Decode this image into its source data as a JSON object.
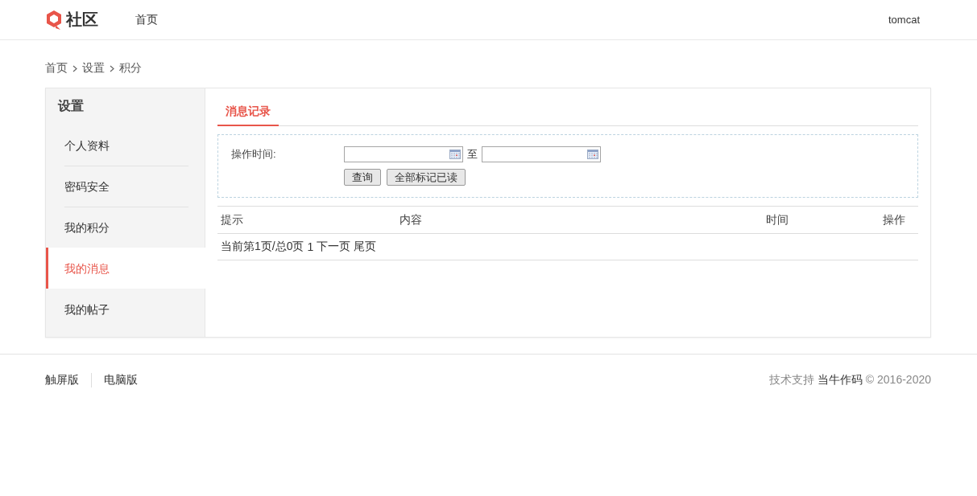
{
  "header": {
    "logo_text": "社区",
    "nav": [
      {
        "label": "首页",
        "selected": false
      }
    ],
    "user": "tomcat"
  },
  "breadcrumb": [
    "首页",
    "设置",
    "积分"
  ],
  "sidebar": {
    "title": "设置",
    "items": [
      {
        "label": "个人资料",
        "selected": false
      },
      {
        "label": "密码安全",
        "selected": false
      },
      {
        "label": "我的积分",
        "selected": false
      },
      {
        "label": "我的消息",
        "selected": true
      },
      {
        "label": "我的帖子",
        "selected": false
      }
    ]
  },
  "tabs": [
    {
      "label": "消息记录",
      "selected": true
    }
  ],
  "filter": {
    "label": "操作时间:",
    "range_separator": "至",
    "buttons": [
      "查询",
      "全部标记已读"
    ]
  },
  "table": {
    "columns": [
      "提示",
      "内容",
      "时间",
      "操作"
    ]
  },
  "pager": {
    "status": "当前第1页/总0页",
    "links": [
      "1",
      "下一页",
      "尾页"
    ]
  },
  "footer": {
    "links": [
      "触屏版",
      "电脑版"
    ],
    "support_label": "技术支持",
    "brand": "当牛作码",
    "copyright": "© 2016-2020"
  }
}
